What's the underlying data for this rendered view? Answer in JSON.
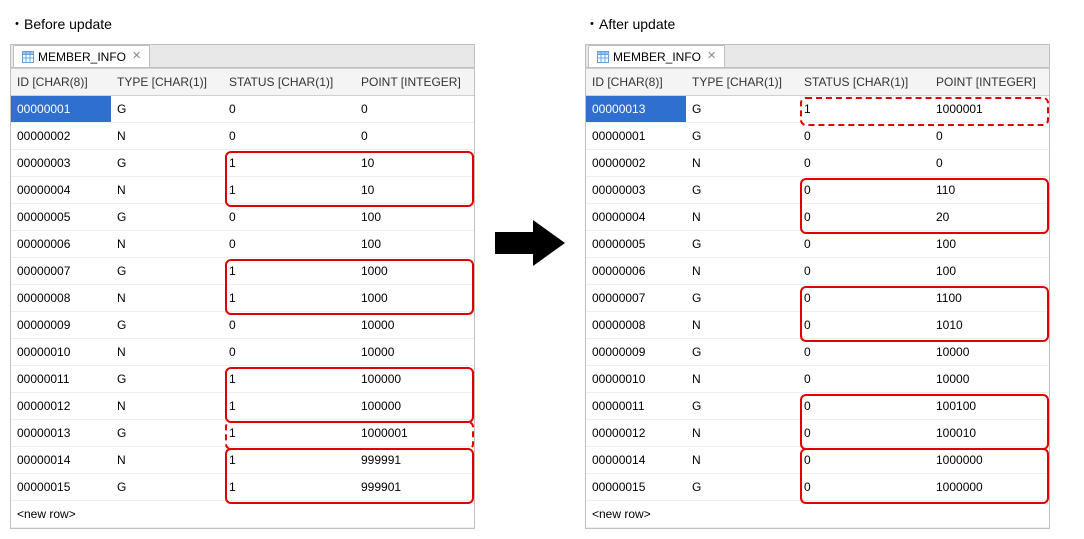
{
  "leftTitle": "Before update",
  "rightTitle": "After update",
  "tabName": "MEMBER_INFO",
  "newRowLabel": "<new row>",
  "columns": [
    "ID [CHAR(8)]",
    "TYPE [CHAR(1)]",
    "STATUS [CHAR(1)]",
    "POINT [INTEGER]"
  ],
  "before": [
    {
      "id": "00000001",
      "type": "G",
      "status": "0",
      "point": "0"
    },
    {
      "id": "00000002",
      "type": "N",
      "status": "0",
      "point": "0"
    },
    {
      "id": "00000003",
      "type": "G",
      "status": "1",
      "point": "10"
    },
    {
      "id": "00000004",
      "type": "N",
      "status": "1",
      "point": "10"
    },
    {
      "id": "00000005",
      "type": "G",
      "status": "0",
      "point": "100"
    },
    {
      "id": "00000006",
      "type": "N",
      "status": "0",
      "point": "100"
    },
    {
      "id": "00000007",
      "type": "G",
      "status": "1",
      "point": "1000"
    },
    {
      "id": "00000008",
      "type": "N",
      "status": "1",
      "point": "1000"
    },
    {
      "id": "00000009",
      "type": "G",
      "status": "0",
      "point": "10000"
    },
    {
      "id": "00000010",
      "type": "N",
      "status": "0",
      "point": "10000"
    },
    {
      "id": "00000011",
      "type": "G",
      "status": "1",
      "point": "100000"
    },
    {
      "id": "00000012",
      "type": "N",
      "status": "1",
      "point": "100000"
    },
    {
      "id": "00000013",
      "type": "G",
      "status": "1",
      "point": "1000001"
    },
    {
      "id": "00000014",
      "type": "N",
      "status": "1",
      "point": "999991"
    },
    {
      "id": "00000015",
      "type": "G",
      "status": "1",
      "point": "999901"
    }
  ],
  "after": [
    {
      "id": "00000013",
      "type": "G",
      "status": "1",
      "point": "1000001"
    },
    {
      "id": "00000001",
      "type": "G",
      "status": "0",
      "point": "0"
    },
    {
      "id": "00000002",
      "type": "N",
      "status": "0",
      "point": "0"
    },
    {
      "id": "00000003",
      "type": "G",
      "status": "0",
      "point": "110"
    },
    {
      "id": "00000004",
      "type": "N",
      "status": "0",
      "point": "20"
    },
    {
      "id": "00000005",
      "type": "G",
      "status": "0",
      "point": "100"
    },
    {
      "id": "00000006",
      "type": "N",
      "status": "0",
      "point": "100"
    },
    {
      "id": "00000007",
      "type": "G",
      "status": "0",
      "point": "1100"
    },
    {
      "id": "00000008",
      "type": "N",
      "status": "0",
      "point": "1010"
    },
    {
      "id": "00000009",
      "type": "G",
      "status": "0",
      "point": "10000"
    },
    {
      "id": "00000010",
      "type": "N",
      "status": "0",
      "point": "10000"
    },
    {
      "id": "00000011",
      "type": "G",
      "status": "0",
      "point": "100100"
    },
    {
      "id": "00000012",
      "type": "N",
      "status": "0",
      "point": "100010"
    },
    {
      "id": "00000014",
      "type": "N",
      "status": "0",
      "point": "1000000"
    },
    {
      "id": "00000015",
      "type": "G",
      "status": "0",
      "point": "1000000"
    }
  ],
  "beforeHighlights": [
    {
      "rows": [
        2,
        3
      ],
      "dashed": false
    },
    {
      "rows": [
        6,
        7
      ],
      "dashed": false
    },
    {
      "rows": [
        10,
        11
      ],
      "dashed": false
    },
    {
      "rows": [
        12,
        12
      ],
      "dashed": true
    },
    {
      "rows": [
        13,
        14
      ],
      "dashed": false
    }
  ],
  "afterHighlights": [
    {
      "rows": [
        0,
        0
      ],
      "dashed": true
    },
    {
      "rows": [
        3,
        4
      ],
      "dashed": false
    },
    {
      "rows": [
        7,
        8
      ],
      "dashed": false
    },
    {
      "rows": [
        11,
        12
      ],
      "dashed": false
    },
    {
      "rows": [
        13,
        14
      ],
      "dashed": false
    }
  ]
}
